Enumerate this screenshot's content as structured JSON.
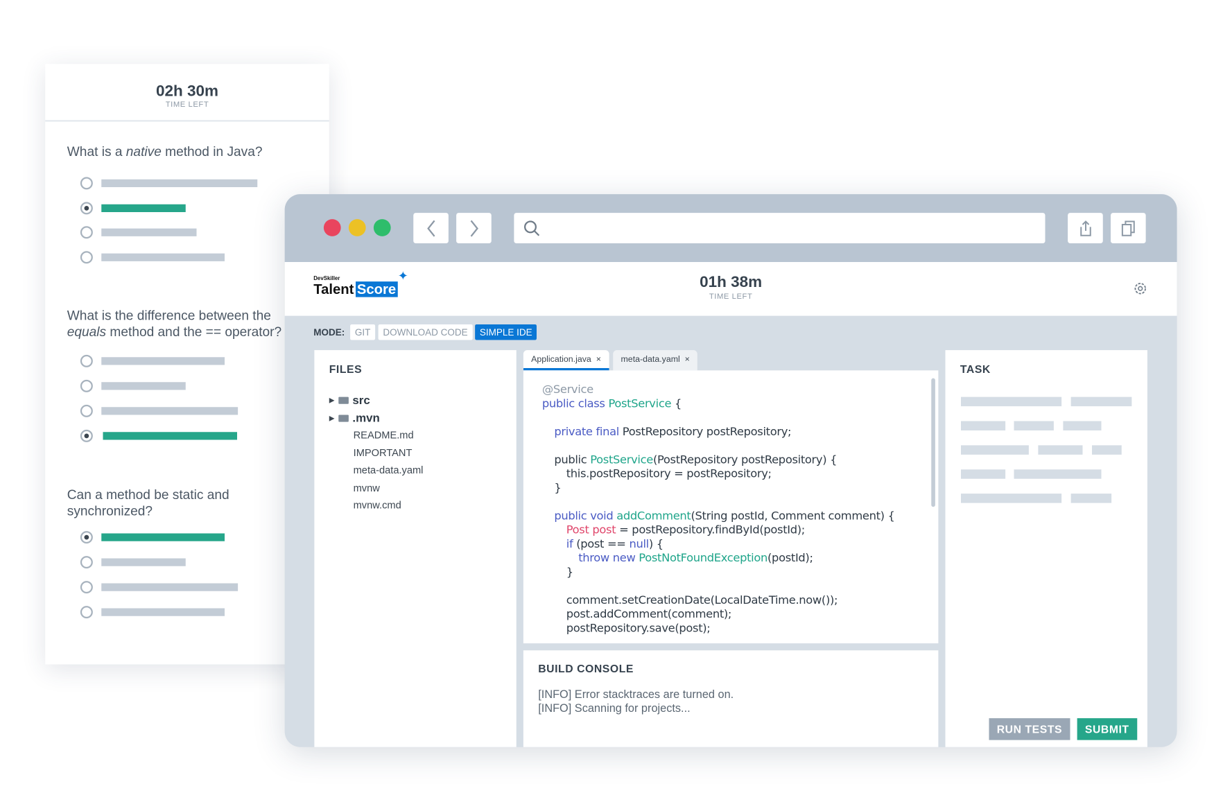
{
  "quiz": {
    "timer": "02h 30m",
    "timer_label": "TIME LEFT",
    "questions": [
      {
        "text_before": "What is a ",
        "text_em": "native",
        "text_after": " method in Java?",
        "selected": 1
      },
      {
        "line1": "What is the difference between the",
        "line2_em": "equals",
        "line2_rest": " method and the == operator?",
        "selected": 3
      },
      {
        "line1": "Can a method be static and",
        "line2": "synchronized?",
        "selected": 0
      }
    ]
  },
  "browser": {
    "traffic_lights": [
      "#e9455e",
      "#ecc125",
      "#2ebd6b"
    ],
    "icons": [
      "chevron-left-icon",
      "chevron-right-icon",
      "search-icon",
      "share-icon",
      "copy-icon"
    ]
  },
  "app": {
    "logo_small": "DevSkiller",
    "logo_talent": "Talent",
    "logo_score": "Score",
    "timer": "01h 38m",
    "timer_label": "TIME LEFT",
    "mode_label": "MODE:",
    "modes": [
      "GIT",
      "DOWNLOAD CODE",
      "SIMPLE IDE"
    ],
    "active_mode": "SIMPLE IDE",
    "files_title": "FILES",
    "folders": [
      "src",
      ".mvn"
    ],
    "files": [
      "README.md",
      "IMPORTANT",
      "meta-data.yaml",
      "mvnw",
      "mvnw.cmd"
    ],
    "tabs": [
      "Application.java",
      "meta-data.yaml"
    ],
    "tab_close": "×",
    "active_tab": "Application.java",
    "code": [
      [
        [
          0,
          "@Service",
          "ann"
        ]
      ],
      [
        [
          0,
          "public class ",
          "kw"
        ],
        [
          0,
          "PostService",
          "cls"
        ],
        [
          0,
          " {",
          ""
        ]
      ],
      [],
      [
        [
          1,
          "private final ",
          "kw"
        ],
        [
          1,
          "PostRepository postRepository;",
          ""
        ]
      ],
      [],
      [
        [
          1,
          "public ",
          ""
        ],
        [
          1,
          "PostService",
          "cls"
        ],
        [
          1,
          "(PostRepository postRepository) {",
          ""
        ]
      ],
      [
        [
          2,
          "this.postRepository = postRepository;",
          ""
        ]
      ],
      [
        [
          1,
          "}",
          ""
        ]
      ],
      [],
      [
        [
          1,
          "public void ",
          "kw"
        ],
        [
          1,
          "addComment",
          "cls"
        ],
        [
          1,
          "(String postId, Comment comment) {",
          ""
        ]
      ],
      [
        [
          2,
          "Post post",
          "red"
        ],
        [
          2,
          " = postRepository.findById(postId);",
          ""
        ]
      ],
      [
        [
          2,
          "if ",
          "kw"
        ],
        [
          2,
          "(post == ",
          ""
        ],
        [
          2,
          "null",
          "kw"
        ],
        [
          2,
          ") {",
          ""
        ]
      ],
      [
        [
          3,
          "throw new ",
          "kw"
        ],
        [
          3,
          "PostNotFoundException",
          "cls"
        ],
        [
          3,
          "(postId);",
          ""
        ]
      ],
      [
        [
          2,
          "}",
          ""
        ]
      ],
      [],
      [
        [
          2,
          "comment.setCreationDate(LocalDateTime.now());",
          ""
        ]
      ],
      [
        [
          2,
          "post.addComment(comment);",
          ""
        ]
      ],
      [
        [
          2,
          "postRepository.save(post);",
          ""
        ]
      ]
    ],
    "console_title": "BUILD CONSOLE",
    "console": [
      "[INFO] Error stacktraces are turned on.",
      "[INFO] Scanning for projects..."
    ],
    "task_title": "TASK",
    "run_tests": "RUN TESTS",
    "submit": "SUBMIT"
  },
  "colors": {
    "accent": "#0a77d5",
    "green": "#26a68a",
    "keyword": "#4a5bc4",
    "class": "#1fa58a",
    "error": "#e0466b"
  }
}
